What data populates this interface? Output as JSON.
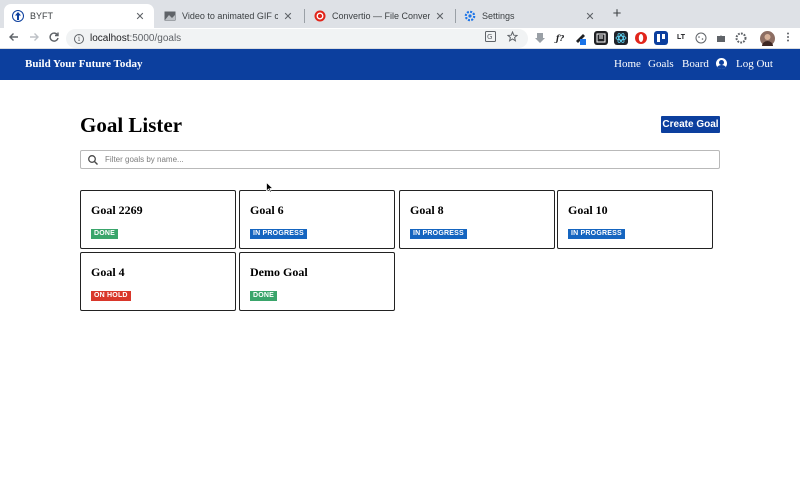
{
  "browser": {
    "tabs": [
      {
        "title": "BYFT",
        "icon": "byft-favicon",
        "active": true
      },
      {
        "title": "Video to animated GIF converter",
        "icon": "image-favicon",
        "active": false
      },
      {
        "title": "Convertio — File Converter",
        "icon": "convertio-favicon",
        "active": false
      },
      {
        "title": "Settings",
        "icon": "gear-icon",
        "active": false
      }
    ],
    "close_glyph": "✕",
    "new_tab_glyph": "+",
    "url_host": "localhost",
    "url_path": ":5000/goals",
    "extensions": [
      "translate",
      "bookmark-star",
      "download",
      "fx",
      "pen",
      "reader",
      "react",
      "opera",
      "trello",
      "lt",
      "cookie",
      "puzzle",
      "settings",
      "avatar"
    ]
  },
  "navbar": {
    "brand": "Build Your Future Today",
    "links": {
      "home": "Home",
      "goals": "Goals",
      "board": "Board",
      "logout": "Log Out"
    },
    "color": "#0c3f9e"
  },
  "main": {
    "title": "Goal Lister",
    "create_button": "Create Goal",
    "filter_placeholder": "Filter goals by name..."
  },
  "goals": [
    {
      "name": "Goal 2269",
      "status": "DONE",
      "status_color": "#3aa56b"
    },
    {
      "name": "Goal 6",
      "status": "IN PROGRESS",
      "status_color": "#1565c0"
    },
    {
      "name": "Goal 8",
      "status": "IN PROGRESS",
      "status_color": "#1565c0"
    },
    {
      "name": "Goal 10",
      "status": "IN PROGRESS",
      "status_color": "#1565c0"
    },
    {
      "name": "Goal 4",
      "status": "ON HOLD",
      "status_color": "#d9372b"
    },
    {
      "name": "Demo Goal",
      "status": "DONE",
      "status_color": "#3aa56b"
    }
  ]
}
